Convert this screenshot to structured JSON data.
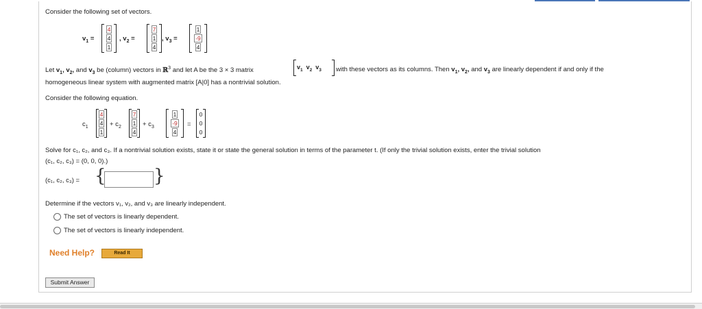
{
  "intro": "Consider the following set of vectors.",
  "vectors": [
    {
      "label": "v",
      "sub": "1",
      "entries": [
        "4",
        "4",
        "1"
      ]
    },
    {
      "label": "v",
      "sub": "2",
      "entries": [
        "7",
        "1",
        "4"
      ]
    },
    {
      "label": "v",
      "sub": "3",
      "entries": [
        "1",
        "-9",
        "4"
      ]
    }
  ],
  "para1_line1_a": "Let",
  "para1_line1_b": "be (column) vectors in",
  "para1_line1_c": "and let A be the 3 × 3 matrix",
  "para1_line1_d": "with these vectors as its columns. Then",
  "para1_line1_e": "are linearly dependent if and only if the",
  "para1_line2": "homogeneous linear system with augmented matrix [A|0] has a nontrivial solution.",
  "rn_symbol": "ℝ",
  "rn_exp": "3",
  "consider_eq": "Consider the following equation.",
  "equation": {
    "c1": "c",
    "c1sub": "1",
    "c2sub": "2",
    "c3sub": "3",
    "plus": "+",
    "equals": "=",
    "zero_vector": [
      "0",
      "0",
      "0"
    ]
  },
  "solve_line1": "Solve for c₁, c₂, and c₃. If a nontrivial solution exists, state it or state the general solution in terms of the parameter t. (If only the trivial solution exists, enter the trivial solution",
  "solve_line2": "(c₁, c₂, c₃) = (0, 0, 0).)",
  "answer_label": "(c₁, c₂, c₃) =",
  "answer_value": "",
  "determine": "Determine if the vectors v₁, v₂, and v₃ are linearly independent.",
  "options": [
    "The set of vectors is linearly dependent.",
    "The set of vectors is linearly independent."
  ],
  "need_help": "Need Help?",
  "read_it": "Read It",
  "submit": "Submit Answer",
  "colors": {
    "accent_orange": "#e0802a",
    "button_gold": "#e7a93b",
    "top_accent": "#4a76b8"
  }
}
